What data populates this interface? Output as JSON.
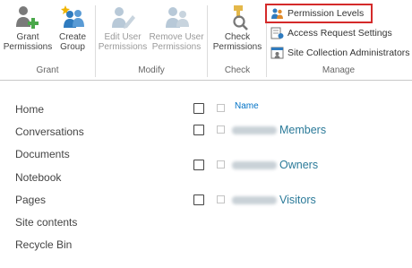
{
  "ribbon": {
    "grant_group": {
      "label": "Grant",
      "buttons": [
        {
          "label": "Grant Permissions",
          "icon": "grant-permissions-icon",
          "enabled": true
        },
        {
          "label": "Create Group",
          "icon": "create-group-icon",
          "enabled": true
        }
      ]
    },
    "modify_group": {
      "label": "Modify",
      "buttons": [
        {
          "label": "Edit User Permissions",
          "icon": "edit-user-permissions-icon",
          "enabled": false
        },
        {
          "label": "Remove User Permissions",
          "icon": "remove-user-permissions-icon",
          "enabled": false
        }
      ]
    },
    "check_group": {
      "label": "Check",
      "buttons": [
        {
          "label": "Check Permissions",
          "icon": "check-permissions-icon",
          "enabled": true
        }
      ]
    },
    "manage_group": {
      "label": "Manage",
      "buttons": [
        {
          "label": "Permission Levels",
          "icon": "permission-levels-icon",
          "highlighted": true
        },
        {
          "label": "Access Request Settings",
          "icon": "access-request-settings-icon"
        },
        {
          "label": "Site Collection Administrators",
          "icon": "site-collection-administrators-icon"
        }
      ]
    }
  },
  "nav": {
    "items": [
      "Home",
      "Conversations",
      "Documents",
      "Notebook",
      "Pages",
      "Site contents",
      "Recycle Bin"
    ]
  },
  "groups": {
    "column_header": "Name",
    "rows": [
      {
        "name": "Members"
      },
      {
        "name": "Owners"
      },
      {
        "name": "Visitors"
      }
    ]
  },
  "colors": {
    "highlight_border": "#d42a2a",
    "link_blue": "#0072c6",
    "group_link": "#2b7a99"
  }
}
